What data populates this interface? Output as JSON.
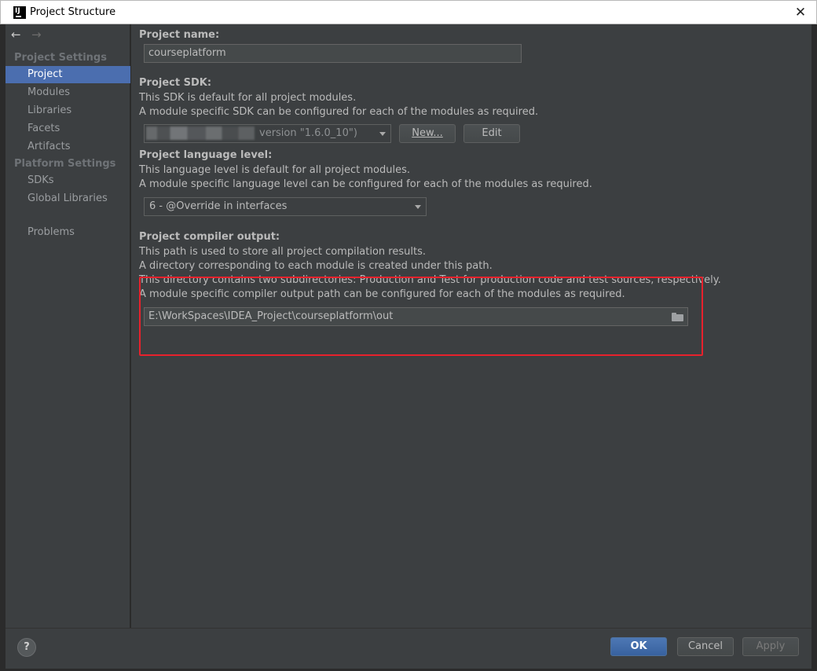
{
  "window": {
    "title": "Project Structure",
    "icon_text": "IJ"
  },
  "nav": {
    "back_icon": "arrow-left-icon",
    "forward_icon": "arrow-right-icon"
  },
  "sidebar": {
    "project_settings_header": "Project Settings",
    "platform_settings_header": "Platform Settings",
    "items": [
      {
        "label": "Project",
        "selected": true
      },
      {
        "label": "Modules"
      },
      {
        "label": "Libraries"
      },
      {
        "label": "Facets"
      },
      {
        "label": "Artifacts"
      },
      {
        "label": "SDKs"
      },
      {
        "label": "Global Libraries"
      },
      {
        "label": "Problems"
      }
    ]
  },
  "main": {
    "project_name": {
      "title": "Project name:",
      "value": "courseplatform"
    },
    "sdk": {
      "title": "Project SDK:",
      "desc1": "This SDK is default for all project modules.",
      "desc2": "A module specific SDK can be configured for each of the modules as required.",
      "combo_value": "version \"1.6.0_10\")",
      "new_button": "New...",
      "edit_button": "Edit"
    },
    "language_level": {
      "title": "Project language level:",
      "desc1": "This language level is default for all project modules.",
      "desc2": "A module specific language level can be configured for each of the modules as required.",
      "combo_value": "6 - @Override in interfaces"
    },
    "compiler_output": {
      "title": "Project compiler output:",
      "desc1": "This path is used to store all project compilation results.",
      "desc2": "A directory corresponding to each module is created under this path.",
      "desc3": "This directory contains two subdirectories: Production and Test for production code and test sources, respectively.",
      "desc4": "A module specific compiler output path can be configured for each of the modules as required.",
      "path_value": "E:\\WorkSpaces\\IDEA_Project\\courseplatform\\out"
    }
  },
  "annotation": {
    "highlight_color": "#e8212c"
  },
  "footer": {
    "help": "?",
    "ok": "OK",
    "cancel": "Cancel",
    "apply": "Apply"
  },
  "colors": {
    "accent": "#4b6eaf",
    "background": "#3c3f41",
    "text": "#bbbbbb"
  }
}
